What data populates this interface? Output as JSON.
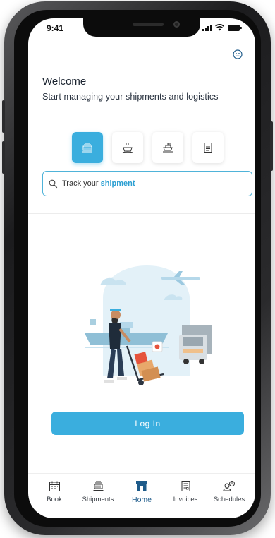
{
  "status_bar": {
    "time": "9:41"
  },
  "welcome": {
    "title": "Welcome",
    "subtitle": "Start managing your shipments and logistics"
  },
  "modes": [
    {
      "icon": "sea-freight-icon",
      "active": true
    },
    {
      "icon": "air-freight-icon",
      "active": false
    },
    {
      "icon": "ship-icon",
      "active": false
    },
    {
      "icon": "document-icon",
      "active": false
    }
  ],
  "search": {
    "prefix": "Track your ",
    "highlight": "shipment"
  },
  "login_button": {
    "label": "Log In"
  },
  "tabs": [
    {
      "label": "Book",
      "icon": "calendar-icon"
    },
    {
      "label": "Shipments",
      "icon": "shipment-icon"
    },
    {
      "label": "Home",
      "icon": "home-icon",
      "active": true
    },
    {
      "label": "Invoices",
      "icon": "invoice-icon"
    },
    {
      "label": "Schedules",
      "icon": "schedules-icon"
    }
  ],
  "colors": {
    "accent": "#3aaede",
    "active_tab": "#1e5b8a",
    "text": "#1b2430"
  }
}
